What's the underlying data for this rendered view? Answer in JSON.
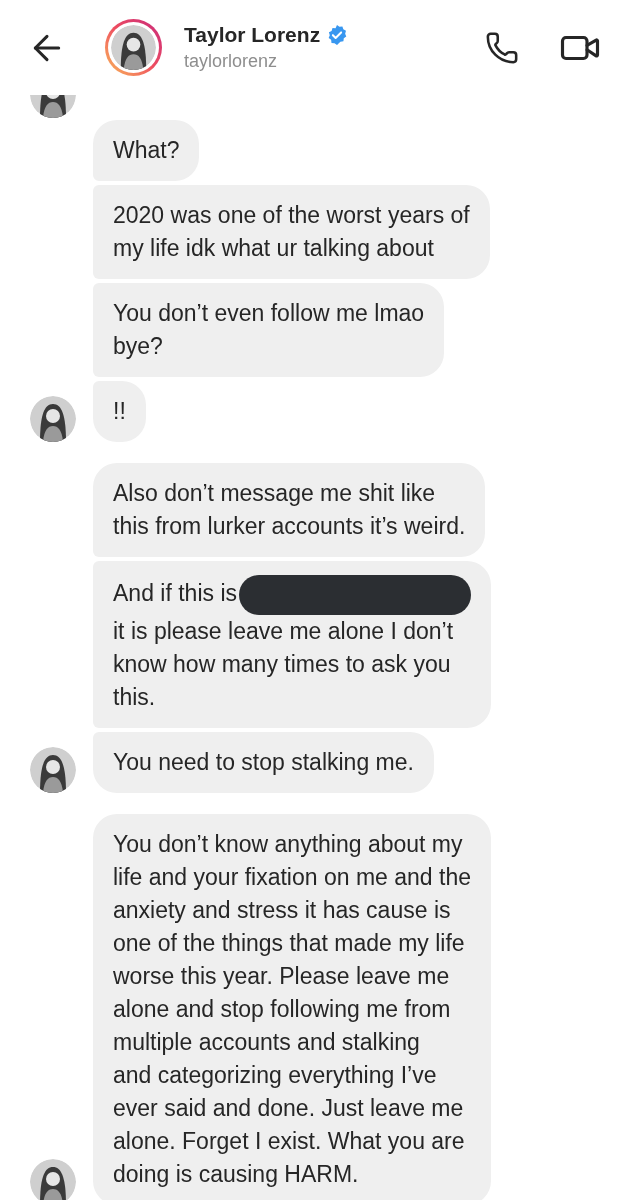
{
  "header": {
    "name": "Taylor Lorenz",
    "verified": true,
    "username": "taylorlorenz",
    "story_ring": true
  },
  "messages": [
    {
      "text": "What?",
      "avatar": false
    },
    {
      "text": "2020 was one of the worst years of\nmy life idk what ur talking about",
      "avatar": false
    },
    {
      "text": "You don’t even follow me lmao\nbye?",
      "avatar": false
    },
    {
      "text": "!!",
      "avatar": true
    },
    {
      "text": "Also don’t message me shit like\nthis from lurker accounts it’s weird.",
      "avatar": false
    },
    {
      "text": "And if this is",
      "redacted": true,
      "text_after": "it is please leave me alone I don’t\nknow how many times to ask you\nthis.",
      "avatar": false
    },
    {
      "text": "You need to stop stalking me.",
      "avatar": true
    },
    {
      "text": "You don’t know anything about my\nlife and your fixation on me and the\nanxiety and stress it has cause is\none of the things that made my life\nworse this year. Please leave me\nalone and stop following me from\nmultiple accounts and stalking\nand categorizing everything I’ve\never said and done. Just leave me\nalone. Forget I exist. What you are\ndoing is causing HARM.",
      "avatar": true
    }
  ]
}
